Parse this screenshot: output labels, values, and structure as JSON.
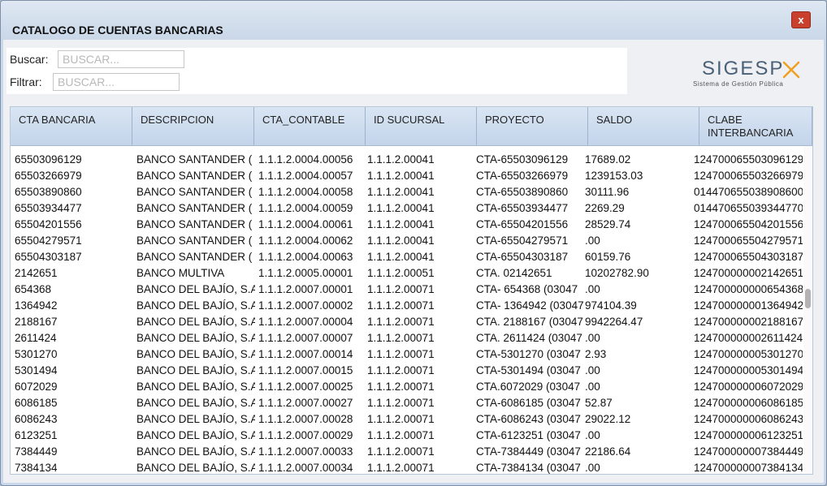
{
  "dialog": {
    "title": "CATALOGO DE CUENTAS BANCARIAS",
    "close_label": "x"
  },
  "search": {
    "buscar_label": "Buscar:",
    "buscar_placeholder": "BUSCAR...",
    "filtrar_label": "Filtrar:",
    "filtrar_placeholder": "BUSCAR..."
  },
  "logo": {
    "main": "SIGESP",
    "sub": "Sistema de Gestión Pública"
  },
  "colors": {
    "close_button": "#c9402c",
    "header_bg": "#cfdcee",
    "logo_accent": "#f0a020"
  },
  "table": {
    "columns": [
      "CTA BANCARIA",
      "DESCRIPCION",
      "CTA_CONTABLE",
      "ID SUCURSAL",
      "PROYECTO",
      "SALDO",
      "CLABE INTERBANCARIA"
    ],
    "rows": [
      [
        "",
        "",
        "",
        "",
        "",
        "",
        ""
      ],
      [
        "65503096129",
        "BANCO SANTANDER ( M",
        "1.1.1.2.0004.00056",
        "1.1.1.2.00041",
        "CTA-65503096129",
        "17689.02",
        "124700065503096129"
      ],
      [
        "65503266979",
        "BANCO SANTANDER ( M",
        "1.1.1.2.0004.00057",
        "1.1.1.2.00041",
        "CTA-65503266979",
        "1239153.03",
        "124700065503266979"
      ],
      [
        "65503890860",
        "BANCO SANTANDER ( M",
        "1.1.1.2.0004.00058",
        "1.1.1.2.00041",
        "CTA-65503890860",
        "30111.96",
        "014470655038908600"
      ],
      [
        "65503934477",
        "BANCO SANTANDER ( M",
        "1.1.1.2.0004.00059",
        "1.1.1.2.00041",
        "CTA-65503934477",
        "2269.29",
        "014470655039344770"
      ],
      [
        "65504201556",
        "BANCO SANTANDER ( M",
        "1.1.1.2.0004.00061",
        "1.1.1.2.00041",
        "CTA-65504201556",
        "28529.74",
        "124700065504201556"
      ],
      [
        "65504279571",
        "BANCO SANTANDER ( M",
        "1.1.1.2.0004.00062",
        "1.1.1.2.00041",
        "CTA-65504279571",
        ".00",
        "124700065504279571"
      ],
      [
        "65504303187",
        "BANCO SANTANDER ( M",
        "1.1.1.2.0004.00063",
        "1.1.1.2.00041",
        "CTA-65504303187",
        "60159.76",
        "124700065504303187"
      ],
      [
        "2142651",
        "BANCO MULTIVA",
        "1.1.1.2.0005.00001",
        "1.1.1.2.00051",
        "CTA. 02142651",
        "10202782.90",
        "124700000002142651"
      ],
      [
        "654368",
        "BANCO DEL BAJÍO, S.A.",
        "1.1.1.2.0007.00001",
        "1.1.1.2.00071",
        "CTA- 654368 (03047",
        ".00",
        "124700000000654368"
      ],
      [
        "1364942",
        "BANCO DEL BAJÍO, S.A.",
        "1.1.1.2.0007.00002",
        "1.1.1.2.00071",
        "CTA- 1364942 (03047",
        "974104.39",
        "124700000001364942"
      ],
      [
        "2188167",
        "BANCO DEL BAJÍO, S.A.",
        "1.1.1.2.0007.00004",
        "1.1.1.2.00071",
        "CTA. 2188167 (03047",
        "9942264.47",
        "124700000002188167"
      ],
      [
        "2611424",
        "BANCO DEL BAJÍO, S.A.",
        "1.1.1.2.0007.00007",
        "1.1.1.2.00071",
        "CTA. 2611424 (03047",
        ".00",
        "124700000002611424"
      ],
      [
        "5301270",
        "BANCO DEL BAJÍO, S.A.",
        "1.1.1.2.0007.00014",
        "1.1.1.2.00071",
        "CTA-5301270 (03047",
        "2.93",
        "124700000005301270"
      ],
      [
        "5301494",
        "BANCO DEL BAJÍO, S.A.",
        "1.1.1.2.0007.00015",
        "1.1.1.2.00071",
        "CTA-5301494 (03047",
        ".00",
        "124700000005301494"
      ],
      [
        "6072029",
        "BANCO DEL BAJÍO, S.A.",
        "1.1.1.2.0007.00025",
        "1.1.1.2.00071",
        "CTA.6072029 (03047",
        ".00",
        "124700000006072029"
      ],
      [
        "6086185",
        "BANCO DEL BAJÍO, S.A.",
        "1.1.1.2.0007.00027",
        "1.1.1.2.00071",
        "CTA-6086185 (03047",
        "52.87",
        "124700000006086185"
      ],
      [
        "6086243",
        "BANCO DEL BAJÍO, S.A.",
        "1.1.1.2.0007.00028",
        "1.1.1.2.00071",
        "CTA-6086243 (03047",
        "29022.12",
        "124700000006086243"
      ],
      [
        "6123251",
        "BANCO DEL BAJÍO, S.A.",
        "1.1.1.2.0007.00029",
        "1.1.1.2.00071",
        "CTA-6123251 (03047",
        ".00",
        "124700000006123251"
      ],
      [
        "7384449",
        "BANCO DEL BAJÍO, S.A.",
        "1.1.1.2.0007.00033",
        "1.1.1.2.00071",
        "CTA-7384449 (03047",
        "22186.64",
        "124700000007384449"
      ],
      [
        "7384134",
        "BANCO DEL BAJÍO, S.A.",
        "1.1.1.2.0007.00034",
        "1.1.1.2.00071",
        "CTA-7384134 (03047",
        ".00",
        "124700000007384134"
      ]
    ]
  }
}
